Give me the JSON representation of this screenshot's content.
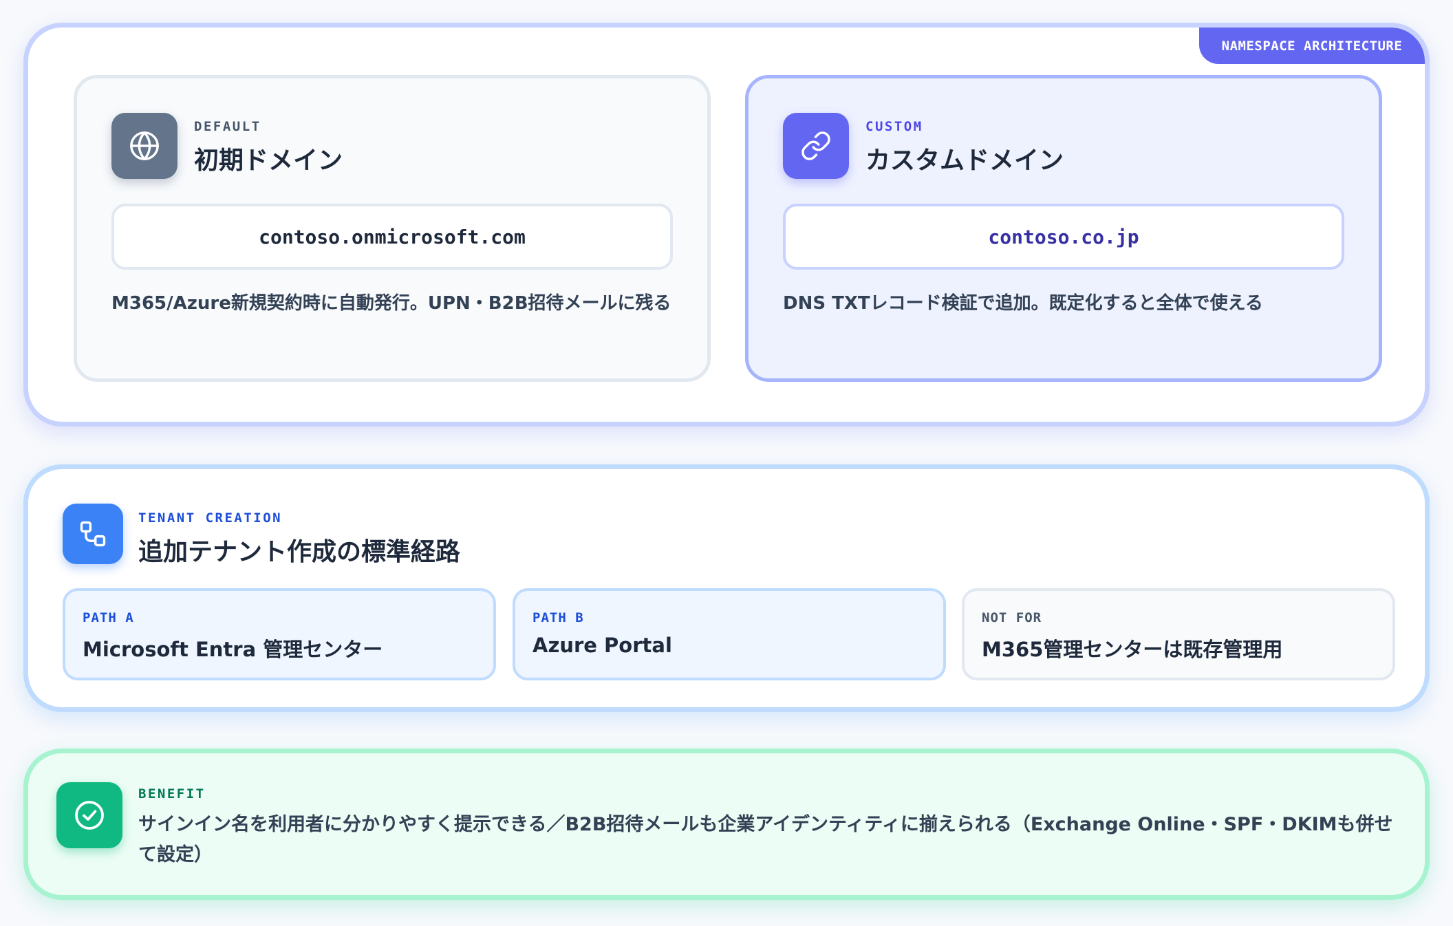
{
  "namespace": {
    "badge": "NAMESPACE ARCHITECTURE",
    "default_card": {
      "eyebrow": "DEFAULT",
      "title": "初期ドメイン",
      "domain": "contoso.onmicrosoft.com",
      "description": "M365/Azure新規契約時に自動発行。UPN・B2B招待メールに残る",
      "icon": "globe-icon"
    },
    "custom_card": {
      "eyebrow": "CUSTOM",
      "title": "カスタムドメイン",
      "domain": "contoso.co.jp",
      "description": "DNS TXTレコード検証で追加。既定化すると全体で使える",
      "icon": "link-icon"
    }
  },
  "tenant": {
    "eyebrow": "TENANT CREATION",
    "title": "追加テナント作成の標準経路",
    "icon": "workflow-icon",
    "paths": [
      {
        "label": "PATH A",
        "name": "Microsoft Entra 管理センター"
      },
      {
        "label": "PATH B",
        "name": "Azure Portal"
      },
      {
        "label": "NOT FOR",
        "name": "M365管理センターは既存管理用"
      }
    ]
  },
  "benefit": {
    "eyebrow": "BENEFIT",
    "text": "サインイン名を利用者に分かりやすく提示できる／B2B招待メールも企業アイデンティティに揃えられる（Exchange Online・SPF・DKIMも併せて設定）",
    "icon": "check-circle-icon"
  },
  "colors": {
    "indigo": "#6366f1",
    "slate": "#64748b",
    "blue": "#3b82f6",
    "green": "#10b981"
  }
}
